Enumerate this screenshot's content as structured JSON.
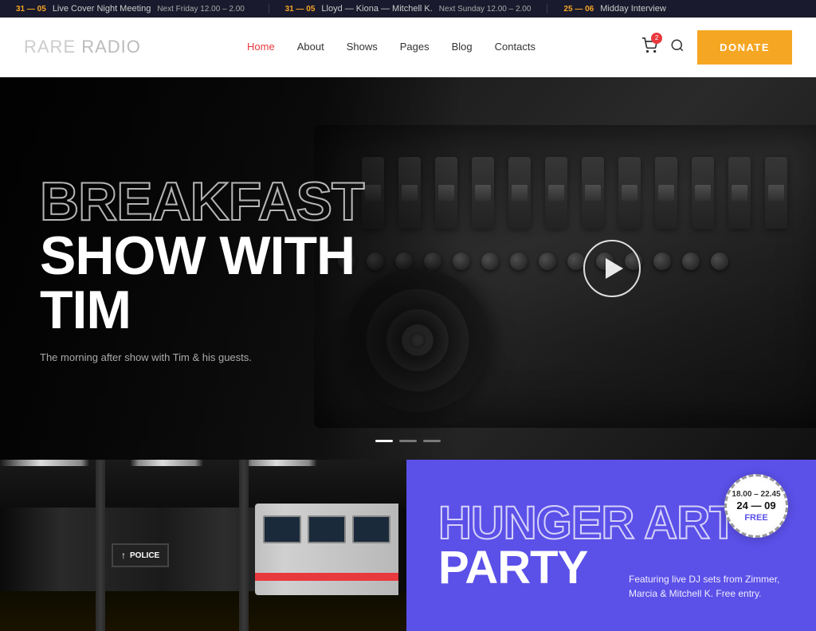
{
  "ticker": {
    "items": [
      {
        "date": "31 — 05",
        "title": "Live Cover Night Meeting",
        "time": "Next Friday 12.00 – 2.00"
      },
      {
        "date": "31 — 05",
        "title": "Lloyd — Kiona — Mitchell K.",
        "time": "Next Sunday 12.00 – 2.00"
      },
      {
        "date": "25 — 06",
        "title": "Midday Interview",
        "time": ""
      }
    ]
  },
  "logo": {
    "bold": "RARE",
    "light": " RADIO"
  },
  "nav": {
    "links": [
      {
        "label": "Home",
        "active": true
      },
      {
        "label": "About",
        "active": false
      },
      {
        "label": "Shows",
        "active": false
      },
      {
        "label": "Pages",
        "active": false
      },
      {
        "label": "Blog",
        "active": false
      },
      {
        "label": "Contacts",
        "active": false
      }
    ],
    "cart_count": "2",
    "donate_label": "DONATE"
  },
  "hero": {
    "title_line1": "BREAKFAST",
    "title_line2": "SHOW WITH TIM",
    "subtitle": "The morning after show with Tim & his guests.",
    "dots": [
      {
        "active": true
      },
      {
        "active": false
      },
      {
        "active": false
      }
    ]
  },
  "event": {
    "title_line1": "HUNGER ART",
    "title_line2": "PARTY",
    "description": "Featuring live DJ sets from Zimmer, Marcia & Mitchell K. Free entry.",
    "badge_time": "18.00 – 22.45",
    "badge_date": "24 — 09",
    "badge_free": "FREE"
  },
  "police_sign": {
    "label": "POLICE",
    "arrow": "↑"
  }
}
